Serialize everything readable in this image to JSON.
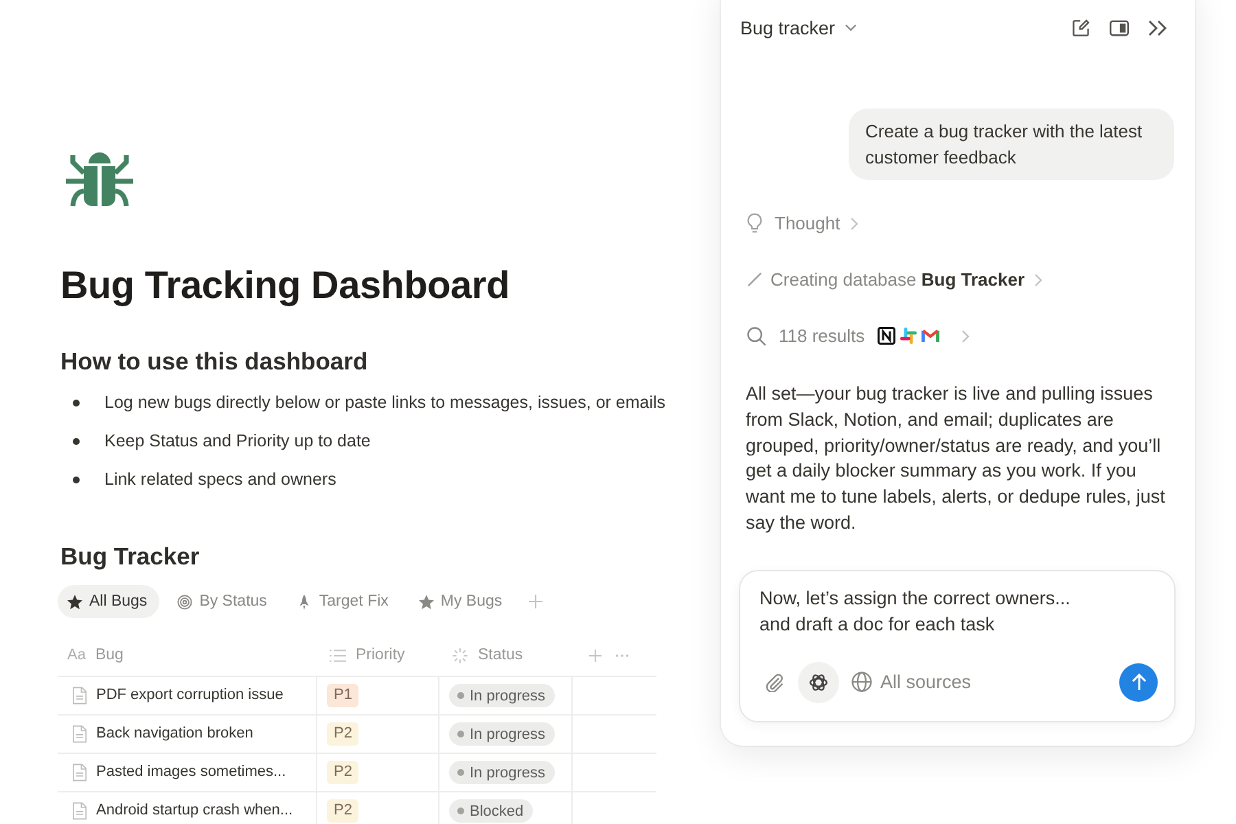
{
  "page": {
    "title": "Bug Tracking Dashboard",
    "intro_heading": "How to use this dashboard",
    "bullets": [
      "Log new bugs directly below or paste links to messages, issues, or emails",
      "Keep Status and Priority up to date",
      "Link related specs and owners"
    ]
  },
  "database": {
    "title": "Bug Tracker",
    "views": [
      {
        "label": "All Bugs",
        "selected": true
      },
      {
        "label": "By Status",
        "selected": false
      },
      {
        "label": "Target Fix",
        "selected": false
      },
      {
        "label": "My Bugs",
        "selected": false
      }
    ],
    "columns": [
      {
        "label": "Bug",
        "kind": "title",
        "glyph": "Aa"
      },
      {
        "label": "Priority",
        "kind": "select"
      },
      {
        "label": "Status",
        "kind": "status"
      }
    ],
    "rows": [
      {
        "bug": "PDF export corruption issue",
        "priority": {
          "label": "P1",
          "color": "#fbe6d8"
        },
        "status": "In progress"
      },
      {
        "bug": "Back navigation broken",
        "priority": {
          "label": "P2",
          "color": "#fbf3dc"
        },
        "status": "In progress"
      },
      {
        "bug": "Pasted images sometimes...",
        "priority": {
          "label": "P2",
          "color": "#fbf3dc"
        },
        "status": "In progress"
      },
      {
        "bug": "Android startup crash when...",
        "priority": {
          "label": "P2",
          "color": "#fbf3dc"
        },
        "status": "Blocked"
      }
    ]
  },
  "assistant": {
    "title": "Bug tracker",
    "user_message": "Create a bug tracker with the latest customer feedback",
    "steps": [
      {
        "kind": "thought",
        "text": "Thought"
      },
      {
        "kind": "action",
        "text": "Creating database **Bug Tracker**"
      },
      {
        "kind": "search",
        "text": "118 results"
      }
    ],
    "reply": "All set—your bug tracker is live and pulling issues from Slack, Notion, and email; duplicates are grouped, priority/owner/status are ready, and you’ll get a daily blocker summary as you work. If you want me to tune labels, alerts, or dedupe rules, just say the word.",
    "composer": {
      "value": "Now, let’s assign the correct owners...\nand draft a doc for each task",
      "sources": "All sources"
    }
  }
}
